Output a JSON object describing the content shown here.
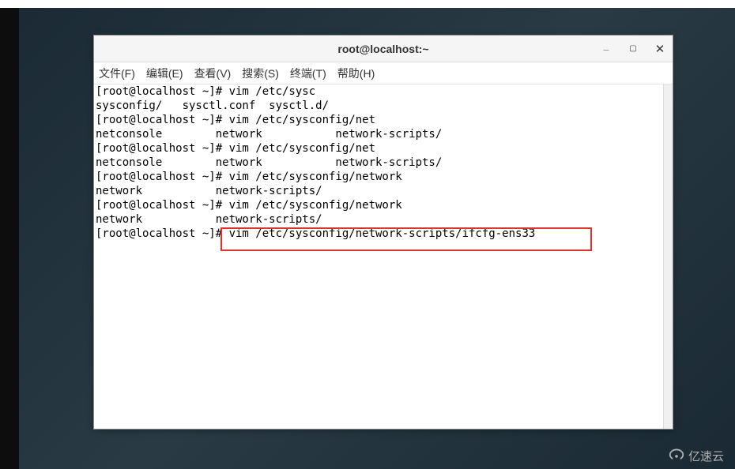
{
  "window": {
    "title": "root@localhost:~"
  },
  "menu": {
    "file": "文件(F)",
    "edit": "编辑(E)",
    "view": "查看(V)",
    "search": "搜索(S)",
    "terminal": "终端(T)",
    "help": "帮助(H)"
  },
  "controls": {
    "minimize": "___",
    "maximize": "□",
    "close": "✕"
  },
  "terminal": {
    "lines": [
      "[root@localhost ~]# vim /etc/sysc",
      "sysconfig/   sysctl.conf  sysctl.d/",
      "[root@localhost ~]# vim /etc/sysconfig/net",
      "netconsole        network           network-scripts/",
      "[root@localhost ~]# vim /etc/sysconfig/net",
      "netconsole        network           network-scripts/",
      "[root@localhost ~]# vim /etc/sysconfig/network",
      "network           network-scripts/",
      "[root@localhost ~]# vim /etc/sysconfig/network",
      "network           network-scripts/",
      "[root@localhost ~]# vim /etc/sysconfig/network-scripts/ifcfg-ens33"
    ]
  },
  "watermark": {
    "text": "亿速云"
  }
}
